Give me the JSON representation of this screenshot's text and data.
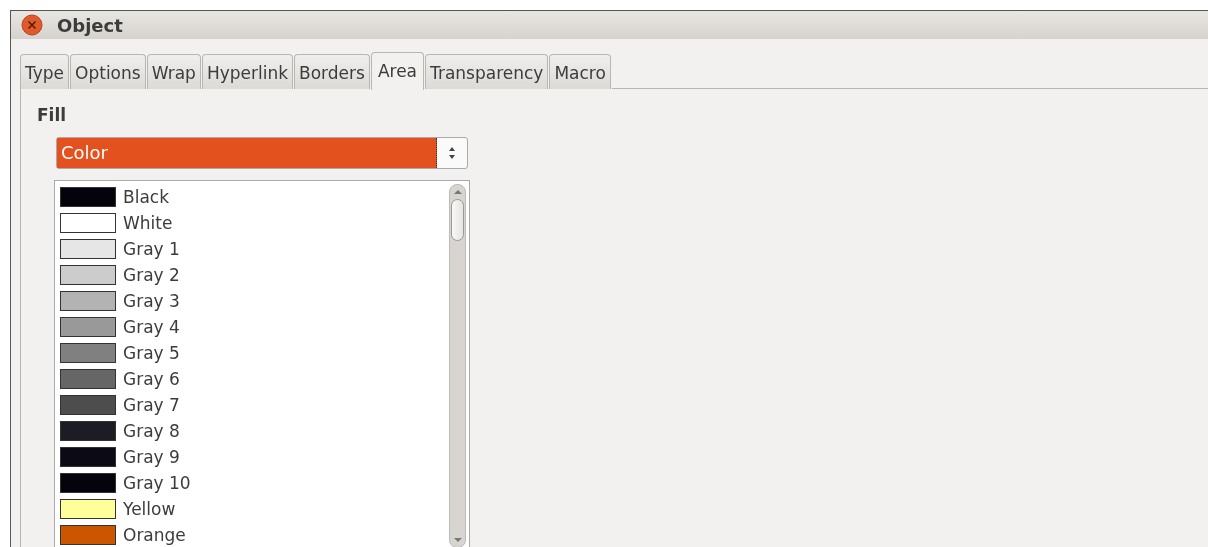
{
  "window": {
    "title": "Object"
  },
  "tabs": [
    {
      "label": "Type",
      "selected": false
    },
    {
      "label": "Options",
      "selected": false
    },
    {
      "label": "Wrap",
      "selected": false
    },
    {
      "label": "Hyperlink",
      "selected": false
    },
    {
      "label": "Borders",
      "selected": false
    },
    {
      "label": "Area",
      "selected": true
    },
    {
      "label": "Transparency",
      "selected": false
    },
    {
      "label": "Macro",
      "selected": false
    }
  ],
  "fill": {
    "label": "Fill",
    "type_value": "Color"
  },
  "colors": [
    {
      "name": "Black",
      "color": "#04030c"
    },
    {
      "name": "White",
      "color": "#ffffff"
    },
    {
      "name": "Gray 1",
      "color": "#e6e6e6"
    },
    {
      "name": "Gray 2",
      "color": "#cccccc"
    },
    {
      "name": "Gray 3",
      "color": "#b3b3b3"
    },
    {
      "name": "Gray 4",
      "color": "#999999"
    },
    {
      "name": "Gray 5",
      "color": "#808080"
    },
    {
      "name": "Gray 6",
      "color": "#666666"
    },
    {
      "name": "Gray 7",
      "color": "#4d4d4d"
    },
    {
      "name": "Gray 8",
      "color": "#1c1c24"
    },
    {
      "name": "Gray 9",
      "color": "#0c0a14"
    },
    {
      "name": "Gray 10",
      "color": "#05040c"
    },
    {
      "name": "Yellow",
      "color": "#ffff99"
    },
    {
      "name": "Orange",
      "color": "#cc5500"
    }
  ]
}
